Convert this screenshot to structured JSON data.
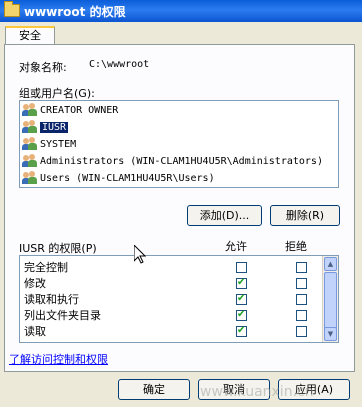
{
  "window": {
    "title": "wwwroot 的权限"
  },
  "tabs": [
    {
      "label": "安全"
    }
  ],
  "object": {
    "label": "对象名称:",
    "value": "C:\\wwwroot"
  },
  "groups": {
    "label": "组或用户名(G):",
    "items": [
      {
        "label": "CREATOR OWNER",
        "selected": false
      },
      {
        "label": "IUSR",
        "selected": true
      },
      {
        "label": "SYSTEM",
        "selected": false
      },
      {
        "label": "Administrators (WIN-CLAM1HU4U5R\\Administrators)",
        "selected": false
      },
      {
        "label": "Users (WIN-CLAM1HU4U5R\\Users)",
        "selected": false
      }
    ]
  },
  "buttons": {
    "add": "添加(D)...",
    "remove": "删除(R)"
  },
  "permissions": {
    "label": "IUSR 的权限(P)",
    "allow_header": "允许",
    "deny_header": "拒绝",
    "rows": [
      {
        "label": "完全控制",
        "allow": false,
        "deny": false
      },
      {
        "label": "修改",
        "allow": true,
        "deny": false
      },
      {
        "label": "读取和执行",
        "allow": true,
        "deny": false
      },
      {
        "label": "列出文件夹目录",
        "allow": true,
        "deny": false
      },
      {
        "label": "读取",
        "allow": true,
        "deny": false
      }
    ]
  },
  "link": "了解访问控制和权限",
  "footer": {
    "ok": "确定",
    "cancel": "取消",
    "apply": "应用(A)"
  },
  "watermark": "www.kuanxin.cn",
  "colors": {
    "title_bar": "#0a5dd8",
    "selection": "#0a246a",
    "check": "#21a121"
  }
}
